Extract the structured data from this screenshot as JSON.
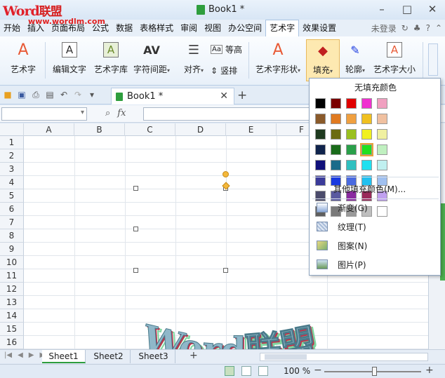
{
  "titlebar": {
    "logo_word": "Word",
    "logo_lian": "联盟",
    "watermark_url": "www.wordlm.com",
    "title": "Book1 *",
    "min_icon": "–",
    "max_icon": "□",
    "close_icon": "✕"
  },
  "menu": {
    "items": [
      "开始",
      "插入",
      "页面布局",
      "公式",
      "数据",
      "表格样式",
      "审阅",
      "视图",
      "办公空间",
      "艺术字",
      "效果设置"
    ],
    "active_index": 9,
    "login": "未登录"
  },
  "ribbon": {
    "wordart": "艺术字",
    "edit_text": "编辑文字",
    "wordart_gallery": "艺术字库",
    "char_spacing": "字符间距",
    "align": "对齐",
    "equal_height": "等高",
    "vertical": "竖排",
    "wordart_shape": "艺术字形状",
    "fill": "填充",
    "outline": "轮廓",
    "wordart_size": "艺术字大小"
  },
  "doctab": {
    "name": "Book1 *"
  },
  "formula": {
    "fx": "fx"
  },
  "grid": {
    "columns": [
      "A",
      "B",
      "C",
      "D",
      "E",
      "F"
    ],
    "rows": [
      "1",
      "2",
      "3",
      "4",
      "5",
      "6",
      "7",
      "8",
      "9",
      "10",
      "11",
      "12",
      "13",
      "14",
      "15",
      "16"
    ]
  },
  "wordart": {
    "text": "Word联盟",
    "colors": {
      "face": "#8fb7c9",
      "shadow1": "#c0304a",
      "shadow2": "#7fd6a0"
    }
  },
  "sheets": {
    "tabs": [
      "Sheet1",
      "Sheet2",
      "Sheet3"
    ],
    "active_index": 0,
    "add": "+"
  },
  "status": {
    "zoom": "100 %",
    "minus": "−",
    "plus": "+",
    "zoom_percent": 100
  },
  "fill_menu": {
    "no_fill": "无填充颜色",
    "colors": [
      [
        "#000000",
        "#8a5a2a",
        "#1f3a1f",
        "#10244c",
        "#10107a",
        "#3b3b9a",
        "#4b4b6b",
        "#5f5f5f"
      ],
      [
        "#7a0000",
        "#e07a20",
        "#6b6b10",
        "#1a6b1a",
        "#1a6b8a",
        "#1a3ae0",
        "#5a5aa0",
        "#7a7a7a"
      ],
      [
        "#e00000",
        "#f0a040",
        "#9ac020",
        "#2aa04a",
        "#30c0c0",
        "#4a6ae0",
        "#8a2aa0",
        "#9a9a9a"
      ],
      [
        "#f030d0",
        "#f0c020",
        "#f0f020",
        "#20e020",
        "#20e0f0",
        "#20c0f0",
        "#9a2a5a",
        "#bfbfbf"
      ],
      [
        "#f0a0c0",
        "#f0c0a0",
        "#f0f0a0",
        "#c0f0c0",
        "#c0f0f0",
        "#a0c0f0",
        "#c0a0f0",
        "#ffffff"
      ]
    ],
    "selected": [
      3,
      3
    ],
    "more_colors": "其他填充颜色(M)...",
    "gradient": "渐变(G)",
    "texture": "纹理(T)",
    "pattern": "图案(N)",
    "picture": "图片(P)"
  }
}
